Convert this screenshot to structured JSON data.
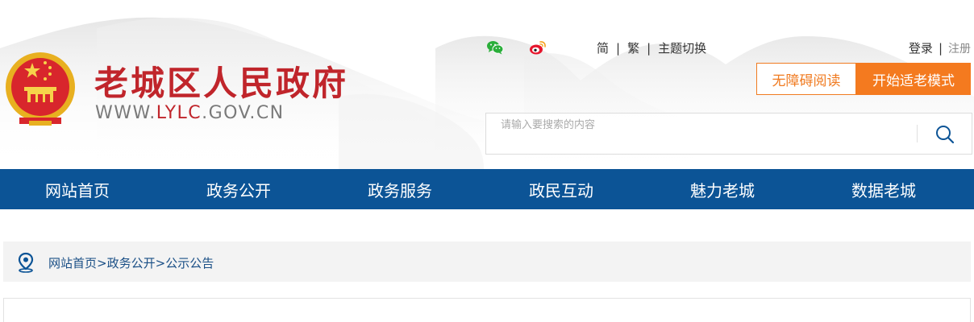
{
  "header": {
    "title": "老城区人民政府",
    "domain_prefix": "WWW.",
    "domain_accent": "LYLC",
    "domain_suffix": ".GOV.CN",
    "social": [
      "wechat-icon",
      "weibo-icon"
    ],
    "toolbar": {
      "simplified": "简",
      "traditional": "繁",
      "theme": "主题切换",
      "separator": "|"
    },
    "auth": {
      "login": "登录",
      "separator": "|",
      "register": "注册"
    },
    "accessibility_button": "无障碍阅读",
    "elder_mode_button": "开始适老模式",
    "search": {
      "placeholder": "请输入要搜索的内容"
    }
  },
  "nav": {
    "items": [
      "网站首页",
      "政务公开",
      "政务服务",
      "政民互动",
      "魅力老城",
      "数据老城"
    ]
  },
  "breadcrumb": {
    "items": [
      "网站首页",
      "政务公开",
      "公示公告"
    ],
    "separator": ">"
  },
  "colors": {
    "brand_red": "#c0252b",
    "nav_blue": "#0c5496",
    "accent_orange": "#f47a1f",
    "breadcrumb_text": "#1a4f86"
  }
}
